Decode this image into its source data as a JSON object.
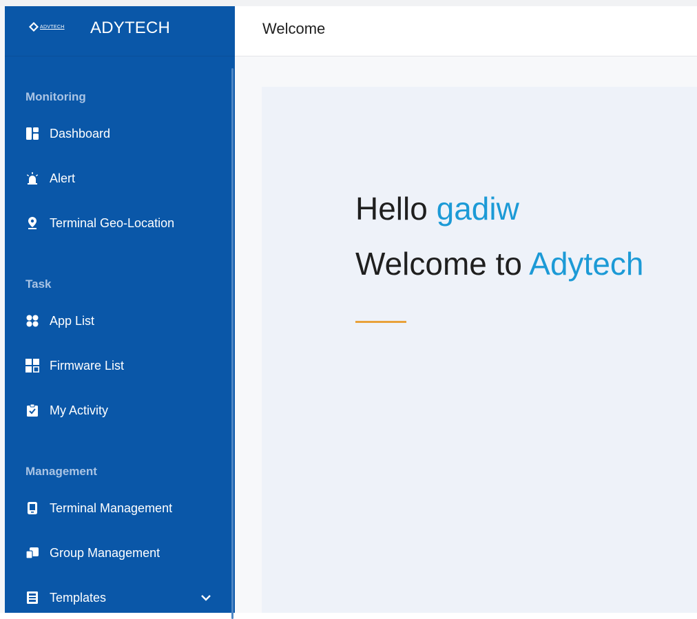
{
  "brand": {
    "logo_text": "ADVTECH",
    "title": "ADYTECH"
  },
  "header": {
    "title": "Welcome"
  },
  "sidebar": {
    "sections": [
      {
        "title": "Monitoring",
        "items": [
          {
            "label": "Dashboard",
            "icon": "dashboard-icon"
          },
          {
            "label": "Alert",
            "icon": "alarm-icon"
          },
          {
            "label": "Terminal Geo-Location",
            "icon": "location-pin-icon"
          }
        ]
      },
      {
        "title": "Task",
        "items": [
          {
            "label": "App List",
            "icon": "apps-icon"
          },
          {
            "label": "Firmware List",
            "icon": "grid-icon"
          },
          {
            "label": "My Activity",
            "icon": "clipboard-check-icon"
          }
        ]
      },
      {
        "title": "Management",
        "items": [
          {
            "label": "Terminal Management",
            "icon": "terminal-device-icon"
          },
          {
            "label": "Group Management",
            "icon": "group-icon"
          },
          {
            "label": "Templates",
            "icon": "template-icon",
            "expandable": true
          }
        ]
      }
    ]
  },
  "main": {
    "greeting_prefix": "Hello",
    "username": "gadiw",
    "welcome_prefix": "Welcome to",
    "welcome_brand": "Adytech"
  },
  "colors": {
    "sidebar_bg": "#0a57a8",
    "accent_blue": "#1c9ad6",
    "divider_orange": "#e8a23a",
    "section_title": "#aac4e4"
  }
}
